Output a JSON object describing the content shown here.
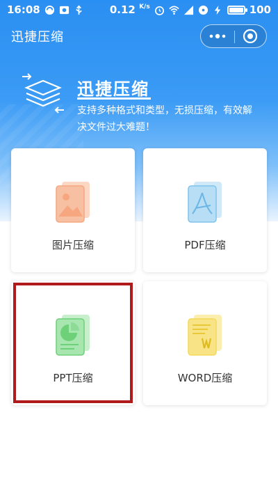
{
  "status_bar": {
    "time": "16:08",
    "speed": "0.12",
    "speed_unit": "K/s",
    "signal": "4G",
    "battery": "100"
  },
  "nav": {
    "title": "迅捷压缩"
  },
  "banner": {
    "title": "迅捷压缩",
    "description": "支持多种格式和类型，无损压缩，有效解决文件过大难题！"
  },
  "cards": [
    {
      "label": "图片压缩",
      "icon": "image-file-icon",
      "color": "#f6a77f"
    },
    {
      "label": "PDF压缩",
      "icon": "pdf-file-icon",
      "color": "#7fc3ec"
    },
    {
      "label": "PPT压缩",
      "icon": "ppt-file-icon",
      "color": "#6fd07a"
    },
    {
      "label": "WORD压缩",
      "icon": "word-file-icon",
      "color": "#f3d95a"
    }
  ],
  "colors": {
    "primary": "#2a8ff2",
    "highlight": "#b01a1a"
  }
}
